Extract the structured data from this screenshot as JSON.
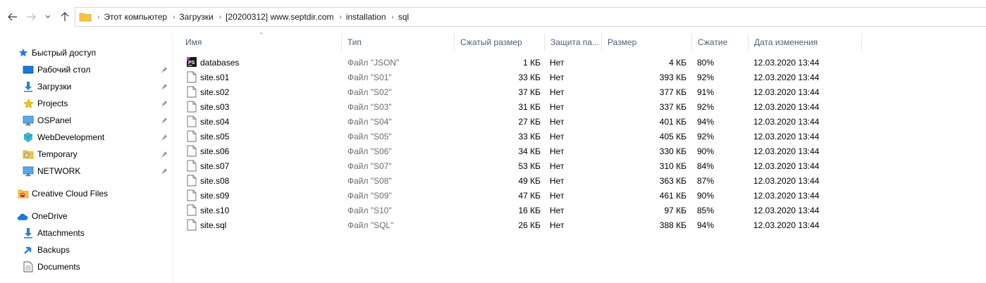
{
  "breadcrumbs": [
    "Этот компьютер",
    "Загрузки",
    "[20200312] www.septdir.com",
    "installation",
    "sql"
  ],
  "sidebar": {
    "items": [
      {
        "label": "Быстрый доступ",
        "icon": "star-blue-icon",
        "pinned": false
      },
      {
        "label": "Рабочий стол",
        "icon": "desktop-icon",
        "pinned": true
      },
      {
        "label": "Загрузки",
        "icon": "download-icon",
        "pinned": true
      },
      {
        "label": "Projects",
        "icon": "star-yellow-icon",
        "pinned": true
      },
      {
        "label": "OSPanel",
        "icon": "monitor-icon",
        "pinned": true
      },
      {
        "label": "WebDevelopment",
        "icon": "cube-icon",
        "pinned": true
      },
      {
        "label": "Temporary",
        "icon": "temp-folder-icon",
        "pinned": true
      },
      {
        "label": "NETWORK",
        "icon": "monitor-icon",
        "pinned": true
      },
      {
        "label": "Creative Cloud Files",
        "icon": "creative-cloud-icon",
        "pinned": false
      },
      {
        "label": "OneDrive",
        "icon": "cloud-icon",
        "pinned": false
      },
      {
        "label": "Attachments",
        "icon": "download-icon",
        "pinned": false
      },
      {
        "label": "Backups",
        "icon": "backup-arrow-icon",
        "pinned": false
      },
      {
        "label": "Documents",
        "icon": "document-icon",
        "pinned": false
      }
    ]
  },
  "columns": {
    "name": "Имя",
    "type": "Тип",
    "compressed": "Сжатый размер",
    "protected": "Защита па...",
    "size": "Размер",
    "ratio": "Сжатие",
    "modified": "Дата изменения"
  },
  "files": [
    {
      "name": "databases",
      "type": "Файл \"JSON\"",
      "compressed": "1 КБ",
      "protected": "Нет",
      "size": "4 КБ",
      "ratio": "80%",
      "modified": "12.03.2020 13:44",
      "icon": "phpstorm-icon"
    },
    {
      "name": "site.s01",
      "type": "Файл \"S01\"",
      "compressed": "33 КБ",
      "protected": "Нет",
      "size": "393 КБ",
      "ratio": "92%",
      "modified": "12.03.2020 13:44",
      "icon": "file-icon"
    },
    {
      "name": "site.s02",
      "type": "Файл \"S02\"",
      "compressed": "37 КБ",
      "protected": "Нет",
      "size": "377 КБ",
      "ratio": "91%",
      "modified": "12.03.2020 13:44",
      "icon": "file-icon"
    },
    {
      "name": "site.s03",
      "type": "Файл \"S03\"",
      "compressed": "31 КБ",
      "protected": "Нет",
      "size": "337 КБ",
      "ratio": "92%",
      "modified": "12.03.2020 13:44",
      "icon": "file-icon"
    },
    {
      "name": "site.s04",
      "type": "Файл \"S04\"",
      "compressed": "27 КБ",
      "protected": "Нет",
      "size": "401 КБ",
      "ratio": "94%",
      "modified": "12.03.2020 13:44",
      "icon": "file-icon"
    },
    {
      "name": "site.s05",
      "type": "Файл \"S05\"",
      "compressed": "33 КБ",
      "protected": "Нет",
      "size": "405 КБ",
      "ratio": "92%",
      "modified": "12.03.2020 13:44",
      "icon": "file-icon"
    },
    {
      "name": "site.s06",
      "type": "Файл \"S06\"",
      "compressed": "34 КБ",
      "protected": "Нет",
      "size": "330 КБ",
      "ratio": "90%",
      "modified": "12.03.2020 13:44",
      "icon": "file-icon"
    },
    {
      "name": "site.s07",
      "type": "Файл \"S07\"",
      "compressed": "53 КБ",
      "protected": "Нет",
      "size": "310 КБ",
      "ratio": "84%",
      "modified": "12.03.2020 13:44",
      "icon": "file-icon"
    },
    {
      "name": "site.s08",
      "type": "Файл \"S08\"",
      "compressed": "49 КБ",
      "protected": "Нет",
      "size": "363 КБ",
      "ratio": "87%",
      "modified": "12.03.2020 13:44",
      "icon": "file-icon"
    },
    {
      "name": "site.s09",
      "type": "Файл \"S09\"",
      "compressed": "47 КБ",
      "protected": "Нет",
      "size": "461 КБ",
      "ratio": "90%",
      "modified": "12.03.2020 13:44",
      "icon": "file-icon"
    },
    {
      "name": "site.s10",
      "type": "Файл \"S10\"",
      "compressed": "16 КБ",
      "protected": "Нет",
      "size": "97 КБ",
      "ratio": "85%",
      "modified": "12.03.2020 13:44",
      "icon": "file-icon"
    },
    {
      "name": "site.sql",
      "type": "Файл \"SQL\"",
      "compressed": "26 КБ",
      "protected": "Нет",
      "size": "388 КБ",
      "ratio": "94%",
      "modified": "12.03.2020 13:44",
      "icon": "file-icon"
    }
  ],
  "colors": {
    "header_text": "#4c607a",
    "folder_yellow": "#f4c542",
    "accent_blue": "#1e78d6"
  }
}
